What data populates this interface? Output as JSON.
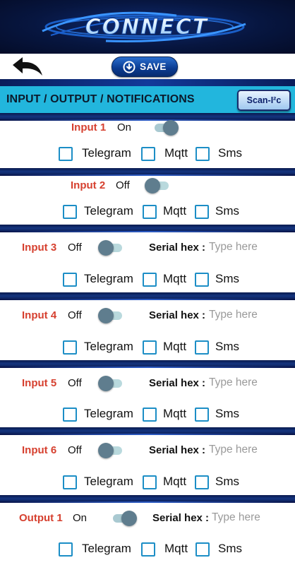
{
  "app": {
    "logo_text": "CONNECT",
    "save_label": "SAVE"
  },
  "header": {
    "title": "INPUT / OUTPUT / NOTIFICATIONS",
    "scan_button": "Scan-I²c"
  },
  "common": {
    "telegram_label": "Telegram",
    "mqtt_label": "Mqtt",
    "sms_label": "Sms",
    "serial_label": "Serial hex :",
    "serial_placeholder": "Type here"
  },
  "items": [
    {
      "label": "Input 1",
      "state_text": "On",
      "enabled": true,
      "has_serial": false,
      "telegram": false,
      "mqtt": false,
      "sms": false
    },
    {
      "label": "Input 2",
      "state_text": "Off",
      "enabled": false,
      "has_serial": false,
      "telegram": false,
      "mqtt": false,
      "sms": false
    },
    {
      "label": "Input 3",
      "state_text": "Off",
      "enabled": false,
      "has_serial": true,
      "serial_value": "",
      "telegram": false,
      "mqtt": false,
      "sms": false
    },
    {
      "label": "Input 4",
      "state_text": "Off",
      "enabled": false,
      "has_serial": true,
      "serial_value": "",
      "telegram": false,
      "mqtt": false,
      "sms": false
    },
    {
      "label": "Input 5",
      "state_text": "Off",
      "enabled": false,
      "has_serial": true,
      "serial_value": "",
      "telegram": false,
      "mqtt": false,
      "sms": false
    },
    {
      "label": "Input 6",
      "state_text": "Off",
      "enabled": false,
      "has_serial": true,
      "serial_value": "",
      "telegram": false,
      "mqtt": false,
      "sms": false
    },
    {
      "label": "Output 1",
      "state_text": "On",
      "enabled": true,
      "has_serial": true,
      "serial_value": "",
      "telegram": false,
      "mqtt": false,
      "sms": false
    }
  ],
  "colors": {
    "title_bar": "#22b6dd",
    "io_label": "#d6402f",
    "checkbox_border": "#1c8ec6",
    "separator": "#0a1a4e"
  }
}
